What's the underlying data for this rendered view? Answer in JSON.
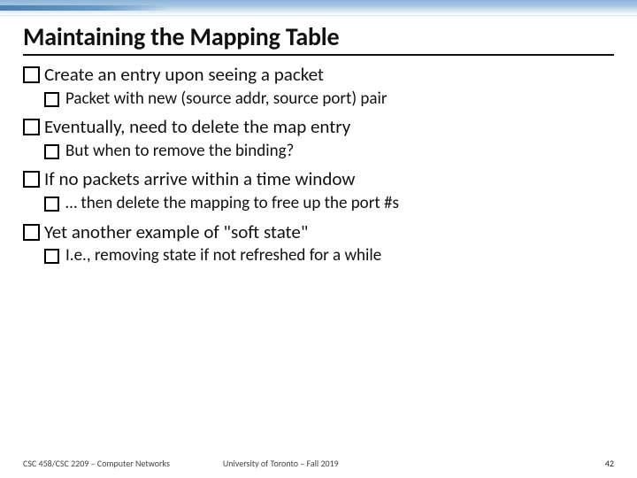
{
  "title": "Maintaining the Mapping Table",
  "bullets": [
    {
      "level": 1,
      "text": "Create an entry upon seeing a packet"
    },
    {
      "level": 2,
      "text": "Packet with new (source addr, source port) pair"
    },
    {
      "level": 1,
      "text": "Eventually, need to delete the map entry"
    },
    {
      "level": 2,
      "text": "But when to remove the binding?"
    },
    {
      "level": 1,
      "text": "If no packets arrive within a time window"
    },
    {
      "level": 2,
      "text": "… then delete the mapping to free up the port #s"
    },
    {
      "level": 1,
      "text": "Yet another example of \"soft state\""
    },
    {
      "level": 2,
      "text": "I.e., removing state if not refreshed for a while"
    }
  ],
  "footer": {
    "left": "CSC 458/CSC 2209 – Computer Networks",
    "center": "University of Toronto – Fall 2019",
    "right": "42"
  }
}
